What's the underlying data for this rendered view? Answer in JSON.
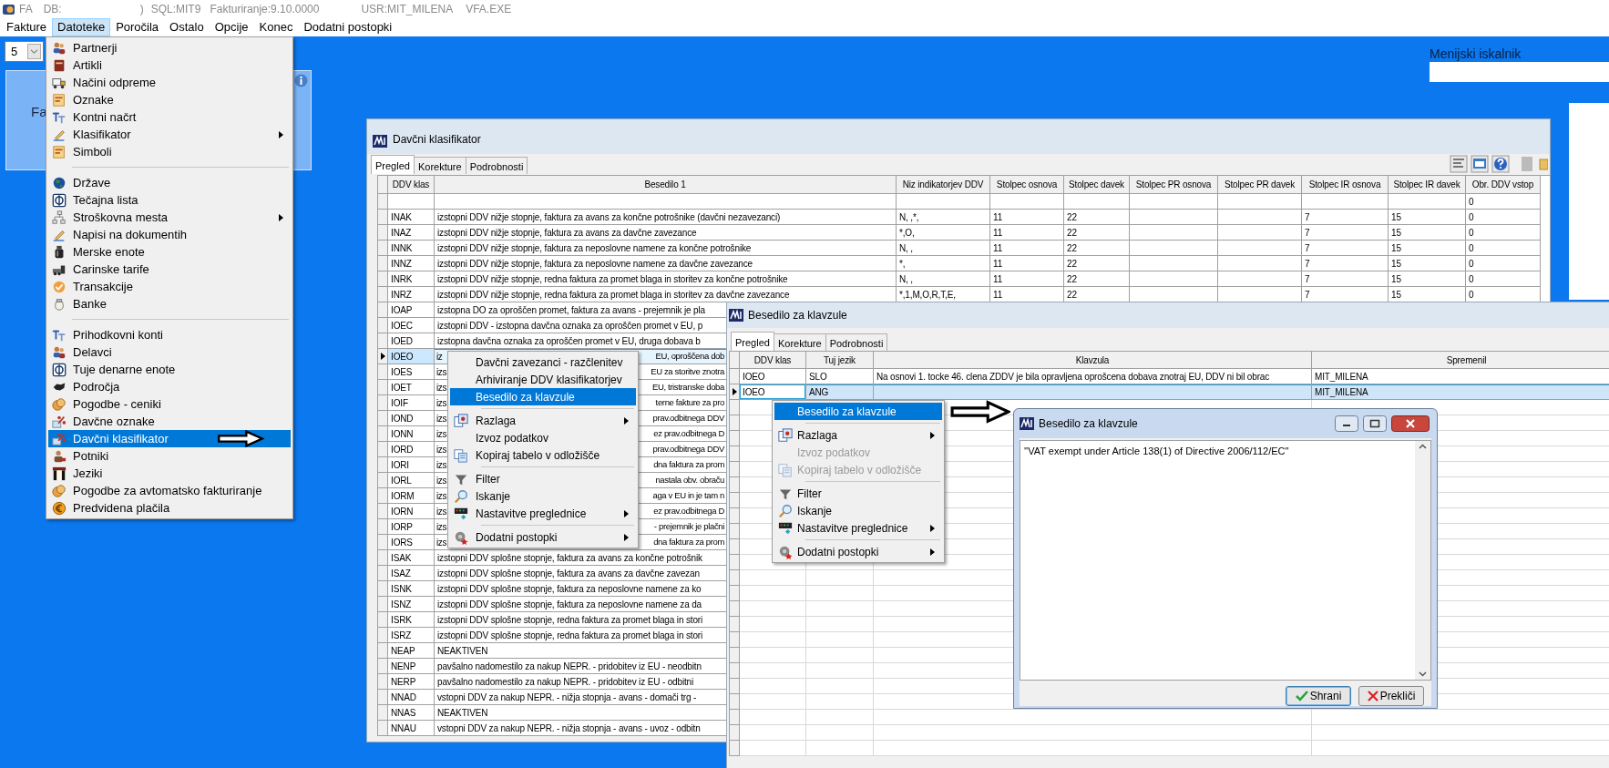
{
  "title_bar": {
    "app": "FA",
    "db": "DB:",
    "db_end": ")",
    "sql": "SQL:MIT9",
    "version": "Fakturiranje:9.10.0000",
    "user": "USR:MIT_MILENA",
    "exe": "VFA.EXE"
  },
  "menu_bar": [
    {
      "label": "Fakture",
      "selected": false
    },
    {
      "label": "Datoteke",
      "selected": true
    },
    {
      "label": "Poročila",
      "selected": false
    },
    {
      "label": "Ostalo",
      "selected": false
    },
    {
      "label": "Opcije",
      "selected": false
    },
    {
      "label": "Konec",
      "selected": false
    },
    {
      "label": "Dodatni postopki",
      "selected": false
    }
  ],
  "desktop": {
    "page_size": "5",
    "panel_text": "Fa",
    "menu_search": {
      "label": "Menijski iskalnik"
    }
  },
  "datoteke_menu": {
    "groups": [
      [
        {
          "label": "Partnerji",
          "submenu": false,
          "selected": false
        },
        {
          "label": "Artikli",
          "submenu": false,
          "selected": false
        },
        {
          "label": "Načini odpreme",
          "submenu": false,
          "selected": false
        },
        {
          "label": "Oznake",
          "submenu": false,
          "selected": false
        },
        {
          "label": "Kontni načrt",
          "submenu": false,
          "selected": false
        },
        {
          "label": "Klasifikator",
          "submenu": true,
          "selected": false
        },
        {
          "label": "Simboli",
          "submenu": false,
          "selected": false
        }
      ],
      [
        {
          "label": "Države",
          "submenu": false,
          "selected": false
        },
        {
          "label": "Tečajna lista",
          "submenu": false,
          "selected": false
        },
        {
          "label": "Stroškovna mesta",
          "submenu": true,
          "selected": false
        },
        {
          "label": "Napisi na dokumentih",
          "submenu": false,
          "selected": false
        },
        {
          "label": "Merske enote",
          "submenu": false,
          "selected": false
        },
        {
          "label": "Carinske tarife",
          "submenu": false,
          "selected": false
        },
        {
          "label": "Transakcije",
          "submenu": false,
          "selected": false
        },
        {
          "label": "Banke",
          "submenu": false,
          "selected": false
        }
      ],
      [
        {
          "label": "Prihodkovni konti",
          "submenu": false,
          "selected": false
        },
        {
          "label": "Delavci",
          "submenu": false,
          "selected": false
        },
        {
          "label": "Tuje denarne enote",
          "submenu": false,
          "selected": false
        },
        {
          "label": "Področja",
          "submenu": false,
          "selected": false
        },
        {
          "label": "Pogodbe - ceniki",
          "submenu": false,
          "selected": false
        },
        {
          "label": "Davčne oznake",
          "submenu": false,
          "selected": false
        },
        {
          "label": "Davčni klasifikator",
          "submenu": false,
          "selected": true
        },
        {
          "label": "Potniki",
          "submenu": false,
          "selected": false
        },
        {
          "label": "Jeziki",
          "submenu": false,
          "selected": false
        },
        {
          "label": "Pogodbe za avtomatsko fakturiranje",
          "submenu": false,
          "selected": false
        },
        {
          "label": "Predvidena plačila",
          "submenu": false,
          "selected": false
        }
      ]
    ]
  },
  "davcni_klasifikator": {
    "title": "Davčni klasifikator",
    "tabs": [
      {
        "label": "Pregled",
        "selected": true
      },
      {
        "label": "Korekture",
        "selected": false
      },
      {
        "label": "Podrobnosti",
        "selected": false
      }
    ],
    "columns": [
      "DDV klas",
      "Besedilo 1",
      "Niz indikatorjev DDV",
      "Stolpec osnova",
      "Stolpec davek",
      "Stolpec PR osnova",
      "Stolpec PR davek",
      "Stolpec IR osnova",
      "Stolpec IR davek",
      "Obr. DDV vstop"
    ],
    "rows": [
      {
        "obr_ddv_vstop": "0",
        "selected": false
      },
      {
        "ddv_klas": "INAK",
        "besedilo_1": "izstopni DDV nižje stopnje, faktura za avans za končne potrošnike (davčni nezavezanci)",
        "niz_indikatorjev_ddv": "N,  ,*,",
        "stolpec_osnova": "11",
        "stolpec_davek": "22",
        "stolpec_ir_osnova": "7",
        "stolpec_ir_davek": "15",
        "obr_ddv_vstop": "0",
        "selected": false
      },
      {
        "ddv_klas": "INAZ",
        "besedilo_1": "izstopni DDV nižje stopnje, faktura za avans za davčne zavezance",
        "niz_indikatorjev_ddv": "*,O,",
        "stolpec_osnova": "11",
        "stolpec_davek": "22",
        "stolpec_ir_osnova": "7",
        "stolpec_ir_davek": "15",
        "obr_ddv_vstop": "0",
        "selected": false
      },
      {
        "ddv_klas": "INNK",
        "besedilo_1": "izstopni DDV nižje stopnje, faktura za neposlovne namene za končne potrošnike",
        "niz_indikatorjev_ddv": "N,  ,",
        "stolpec_osnova": "11",
        "stolpec_davek": "22",
        "stolpec_ir_osnova": "7",
        "stolpec_ir_davek": "15",
        "obr_ddv_vstop": "0",
        "selected": false
      },
      {
        "ddv_klas": "INNZ",
        "besedilo_1": "izstopni DDV nižje stopnje, faktura za neposlovne namene za davčne zavezance",
        "niz_indikatorjev_ddv": "*,",
        "stolpec_osnova": "11",
        "stolpec_davek": "22",
        "stolpec_ir_osnova": "7",
        "stolpec_ir_davek": "15",
        "obr_ddv_vstop": "0",
        "selected": false
      },
      {
        "ddv_klas": "INRK",
        "besedilo_1": "izstopni DDV nižje stopnje, redna faktura za promet blaga in storitev za končne potrošnike",
        "niz_indikatorjev_ddv": "N,  ,",
        "stolpec_osnova": "11",
        "stolpec_davek": "22",
        "stolpec_ir_osnova": "7",
        "stolpec_ir_davek": "15",
        "obr_ddv_vstop": "0",
        "selected": false
      },
      {
        "ddv_klas": "INRZ",
        "besedilo_1": "izstopni DDV nižje stopnje, redna faktura za promet blaga in storitev za davčne zavezance",
        "niz_indikatorjev_ddv": "*,1,M,O,R,T,E,",
        "stolpec_osnova": "11",
        "stolpec_davek": "22",
        "stolpec_ir_osnova": "7",
        "stolpec_ir_davek": "15",
        "obr_ddv_vstop": "0",
        "selected": false
      },
      {
        "ddv_klas": "IOAP",
        "besedilo_1": "izstopna DO za oproščen promet, faktura za avans - prejemnik je pla",
        "selected": false
      },
      {
        "ddv_klas": "IOEC",
        "besedilo_1": "izstopni DDV - izstopna davčna oznaka za oproščen promet v EU, p",
        "selected": false
      },
      {
        "ddv_klas": "IOED",
        "besedilo_1": "izstopna davčna oznaka za oproščen promet v EU, druga dobava b",
        "selected": false
      },
      {
        "ddv_klas": "IOEO",
        "besedilo_1_start": "iz",
        "besedilo_1_end": "EU, oproščena dob",
        "selected": true
      },
      {
        "ddv_klas": "IOES",
        "besedilo_1_start": "izs",
        "besedilo_1_end": "EU za storitve znotra",
        "selected": false
      },
      {
        "ddv_klas": "IOET",
        "besedilo_1_start": "izs",
        "besedilo_1_end": "EU, tristranske doba",
        "selected": false
      },
      {
        "ddv_klas": "IOIF",
        "besedilo_1_start": "izs",
        "besedilo_1_end": "terne fakture za pro",
        "selected": false
      },
      {
        "ddv_klas": "IOND",
        "besedilo_1_start": "izs",
        "besedilo_1_end": "prav.odbitnega DDV",
        "selected": false
      },
      {
        "ddv_klas": "IONN",
        "besedilo_1_start": "izs",
        "besedilo_1_end": "ez prav.odbitnega D",
        "selected": false
      },
      {
        "ddv_klas": "IORD",
        "besedilo_1_start": "izs",
        "besedilo_1_end": "prav.odbitnega DDV",
        "selected": false
      },
      {
        "ddv_klas": "IORI",
        "besedilo_1_start": "izs",
        "besedilo_1_end": "dna faktura za prom",
        "selected": false
      },
      {
        "ddv_klas": "IORL",
        "besedilo_1_start": "izs",
        "besedilo_1_end": "nastala obv. obraču",
        "selected": false
      },
      {
        "ddv_klas": "IORM",
        "besedilo_1_start": "izs",
        "besedilo_1_end": "aga v EU in je tam n",
        "selected": false
      },
      {
        "ddv_klas": "IORN",
        "besedilo_1_start": "izs",
        "besedilo_1_end": "ez prav.odbitnega D",
        "selected": false
      },
      {
        "ddv_klas": "IORP",
        "besedilo_1_start": "izs",
        "besedilo_1_end": "- prejemnik je plačni",
        "selected": false
      },
      {
        "ddv_klas": "IORS",
        "besedilo_1_start": "izs",
        "besedilo_1_end": "dna faktura za prom",
        "selected": false
      },
      {
        "ddv_klas": "ISAK",
        "besedilo_1": "izstopni DDV splošne stopnje, faktura za avans za končne potrošnik",
        "selected": false
      },
      {
        "ddv_klas": "ISAZ",
        "besedilo_1": "izstopni DDV splošne stopnje, faktura za avans za davčne zavezan",
        "selected": false
      },
      {
        "ddv_klas": "ISNK",
        "besedilo_1": "izstopni DDV splošne stopnje, faktura za neposlovne namene za ko",
        "selected": false
      },
      {
        "ddv_klas": "ISNZ",
        "besedilo_1": "izstopni DDV splošne stopnje, faktura za neposlovne namene za da",
        "selected": false
      },
      {
        "ddv_klas": "ISRK",
        "besedilo_1": "izstopni DDV splošne stopnje, redna faktura za promet blaga in stori",
        "selected": false
      },
      {
        "ddv_klas": "ISRZ",
        "besedilo_1": "izstopni DDV splošne stopnje, redna faktura za promet blaga in stori",
        "selected": false
      },
      {
        "ddv_klas": "NEAP",
        "besedilo_1": "NEAKTIVEN",
        "selected": false
      },
      {
        "ddv_klas": "NENP",
        "besedilo_1": "pavšalno nadomestilo za nakup NEPR. - pridobitev iz EU - neodbitn",
        "selected": false
      },
      {
        "ddv_klas": "NERP",
        "besedilo_1": "pavšalno nadomestilo za nakup NEPR. - pridobitev iz EU - odbitni",
        "selected": false
      },
      {
        "ddv_klas": "NNAD",
        "besedilo_1": "vstopni DDV za nakup NEPR. - nižja stopnja - avans - domači trg -",
        "selected": false
      },
      {
        "ddv_klas": "NNAS",
        "besedilo_1": "NEAKTIVEN",
        "selected": false
      },
      {
        "ddv_klas": "NNAU",
        "besedilo_1": "vstopni DDV za nakup NEPR. - nižja stopnja - avans - uvoz - odbitn",
        "selected": false
      }
    ]
  },
  "row_context_menu": {
    "groups": [
      [
        {
          "label": "Davčni zavezanci - razčlenitev",
          "submenu": false,
          "selected": false
        },
        {
          "label": "Arhiviranje DDV klasifikatorjev",
          "submenu": false,
          "selected": false
        },
        {
          "label": "Besedilo za klavzule",
          "submenu": false,
          "selected": true
        }
      ],
      [
        {
          "label": "Razlaga",
          "submenu": true,
          "selected": false
        },
        {
          "label": "Izvoz podatkov",
          "submenu": false,
          "selected": false
        },
        {
          "label": "Kopiraj tabelo v odložišče",
          "submenu": false,
          "selected": false
        }
      ],
      [
        {
          "label": "Filter",
          "submenu": false,
          "selected": false
        },
        {
          "label": "Iskanje",
          "submenu": false,
          "selected": false
        },
        {
          "label": "Nastavitve preglednice",
          "submenu": true,
          "selected": false
        }
      ],
      [
        {
          "label": "Dodatni postopki",
          "submenu": true,
          "selected": false
        }
      ]
    ]
  },
  "besedilo_za_klavzule": {
    "title": "Besedilo za klavzule",
    "tabs": [
      {
        "label": "Pregled",
        "selected": true
      },
      {
        "label": "Korekture",
        "selected": false
      },
      {
        "label": "Podrobnosti",
        "selected": false
      }
    ],
    "columns": [
      "DDV klas",
      "Tuj jezik",
      "Klavzula",
      "Spremenil"
    ],
    "rows": [
      {
        "ddv_klas": "IOEO",
        "tuj_jezik": "SLO",
        "klavzula": "Na osnovi 1. tocke 46. clena ZDDV je bila opravljena oprošcena dobava znotraj EU, DDV ni bil obrac",
        "spremenil": "MIT_MILENA",
        "selected": false
      },
      {
        "ddv_klas": "IOEO",
        "tuj_jezik": "ANG",
        "spremenil": "MIT_MILENA",
        "selected": true
      }
    ]
  },
  "clause_context_menu": {
    "groups": [
      [
        {
          "label": "Besedilo za klavzule",
          "submenu": false,
          "selected": true,
          "disabled": false
        }
      ],
      [
        {
          "label": "Razlaga",
          "submenu": true,
          "selected": false,
          "disabled": false
        },
        {
          "label": "Izvoz podatkov",
          "submenu": false,
          "selected": false,
          "disabled": true
        },
        {
          "label": "Kopiraj tabelo v odložišče",
          "submenu": false,
          "selected": false,
          "disabled": true
        }
      ],
      [
        {
          "label": "Filter",
          "submenu": false,
          "selected": false,
          "disabled": false
        },
        {
          "label": "Iskanje",
          "submenu": false,
          "selected": false,
          "disabled": false
        },
        {
          "label": "Nastavitve preglednice",
          "submenu": true,
          "selected": false,
          "disabled": false
        }
      ],
      [
        {
          "label": "Dodatni postopki",
          "submenu": true,
          "selected": false,
          "disabled": false
        }
      ]
    ]
  },
  "dialog": {
    "title": "Besedilo za klavzule",
    "text": "''VAT exempt under Article 138(1) of Directive 2006/112/EC''",
    "buttons": [
      {
        "label": "Shrani",
        "kind": "save"
      },
      {
        "label": "Prekliči",
        "kind": "cancel"
      }
    ]
  }
}
